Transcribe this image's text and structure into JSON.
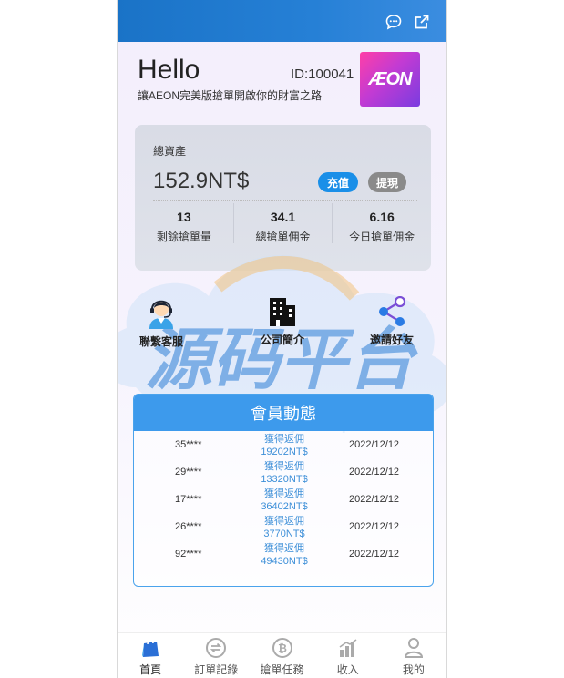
{
  "header": {
    "greeting": "Hello",
    "user_id": "ID:100041",
    "slogan": "讓AEON完美版搶單開啟你的財富之路",
    "logo_text": "ÆON"
  },
  "topbar_icons": [
    "chat-icon",
    "external-link-icon"
  ],
  "assets": {
    "label": "總資產",
    "value": "152.9NT$",
    "recharge_label": "充值",
    "withdraw_label": "提現",
    "stats": [
      {
        "value": "13",
        "label": "剩餘搶單量"
      },
      {
        "value": "34.1",
        "label": "總搶單佣金"
      },
      {
        "value": "6.16",
        "label": "今日搶單佣金"
      }
    ]
  },
  "features": [
    {
      "label": "聯繫客服",
      "icon": "customer-service-icon"
    },
    {
      "label": "公司簡介",
      "icon": "building-icon"
    },
    {
      "label": "邀請好友",
      "icon": "share-icon"
    }
  ],
  "feed": {
    "title": "會員動態",
    "rows": [
      {
        "user": "35****",
        "action": "獲得返佣",
        "amount": "19202NT$",
        "date": "2022/12/12"
      },
      {
        "user": "29****",
        "action": "獲得返佣",
        "amount": "13320NT$",
        "date": "2022/12/12"
      },
      {
        "user": "17****",
        "action": "獲得返佣",
        "amount": "36402NT$",
        "date": "2022/12/12"
      },
      {
        "user": "26****",
        "action": "獲得返佣",
        "amount": "3770NT$",
        "date": "2022/12/12"
      },
      {
        "user": "92****",
        "action": "獲得返佣",
        "amount": "49430NT$",
        "date": "2022/12/12"
      }
    ]
  },
  "watermark": {
    "text": "源码平台",
    "url": "www.ymtpt.cc"
  },
  "tabs": [
    {
      "label": "首頁",
      "icon": "shopping-bag-icon",
      "active": true
    },
    {
      "label": "訂單記錄",
      "icon": "exchange-icon",
      "active": false
    },
    {
      "label": "搶單任務",
      "icon": "bitcoin-icon",
      "active": false
    },
    {
      "label": "收入",
      "icon": "bar-chart-icon",
      "active": false
    },
    {
      "label": "我的",
      "icon": "user-icon",
      "active": false
    }
  ],
  "colors": {
    "primary": "#1a8fe8",
    "topbar": "#2680d6",
    "logo": "#c23bd3"
  }
}
